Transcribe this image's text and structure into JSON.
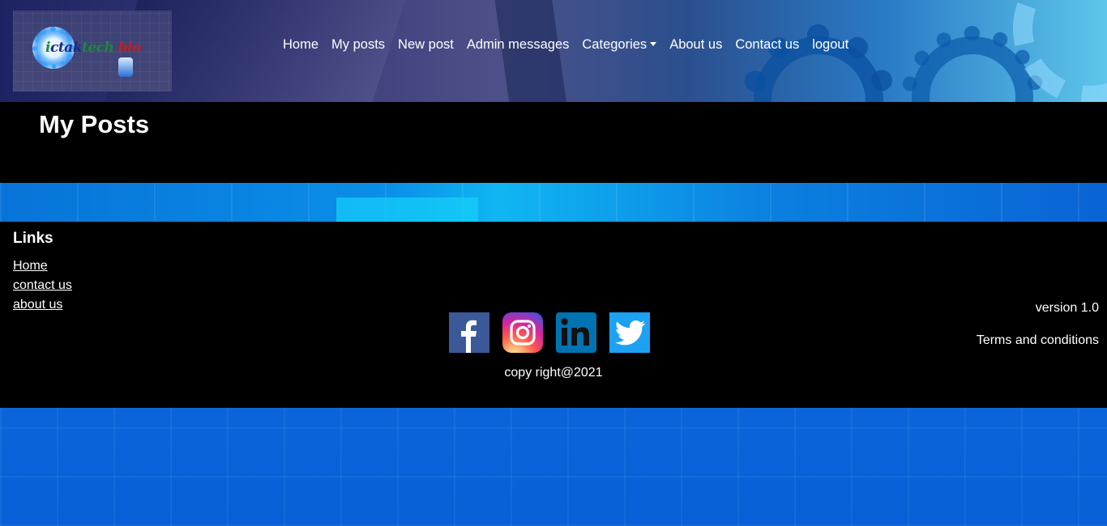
{
  "brand": {
    "logo_text": [
      "i",
      "ctak",
      "tech",
      " blo"
    ]
  },
  "nav": {
    "items": [
      {
        "label": "Home"
      },
      {
        "label": "My posts"
      },
      {
        "label": "New post"
      },
      {
        "label": "Admin messages"
      },
      {
        "label": "Categories",
        "dropdown": true
      },
      {
        "label": "About us"
      },
      {
        "label": "Contact us"
      },
      {
        "label": "logout"
      }
    ]
  },
  "main": {
    "title": "My Posts"
  },
  "footer": {
    "links_title": "Links",
    "links": [
      {
        "label": "Home"
      },
      {
        "label": "contact us"
      },
      {
        "label": "about us"
      }
    ],
    "socials": [
      {
        "name": "facebook-icon"
      },
      {
        "name": "instagram-icon"
      },
      {
        "name": "linkedin-icon"
      },
      {
        "name": "twitter-icon"
      }
    ],
    "copyright": "copy right@2021",
    "version": "version 1.0",
    "terms": "Terms and conditions"
  },
  "colors": {
    "facebook": "#3b5998",
    "linkedin": "#0073b1",
    "twitter": "#1da1f2",
    "footer_bg": "#000000"
  }
}
